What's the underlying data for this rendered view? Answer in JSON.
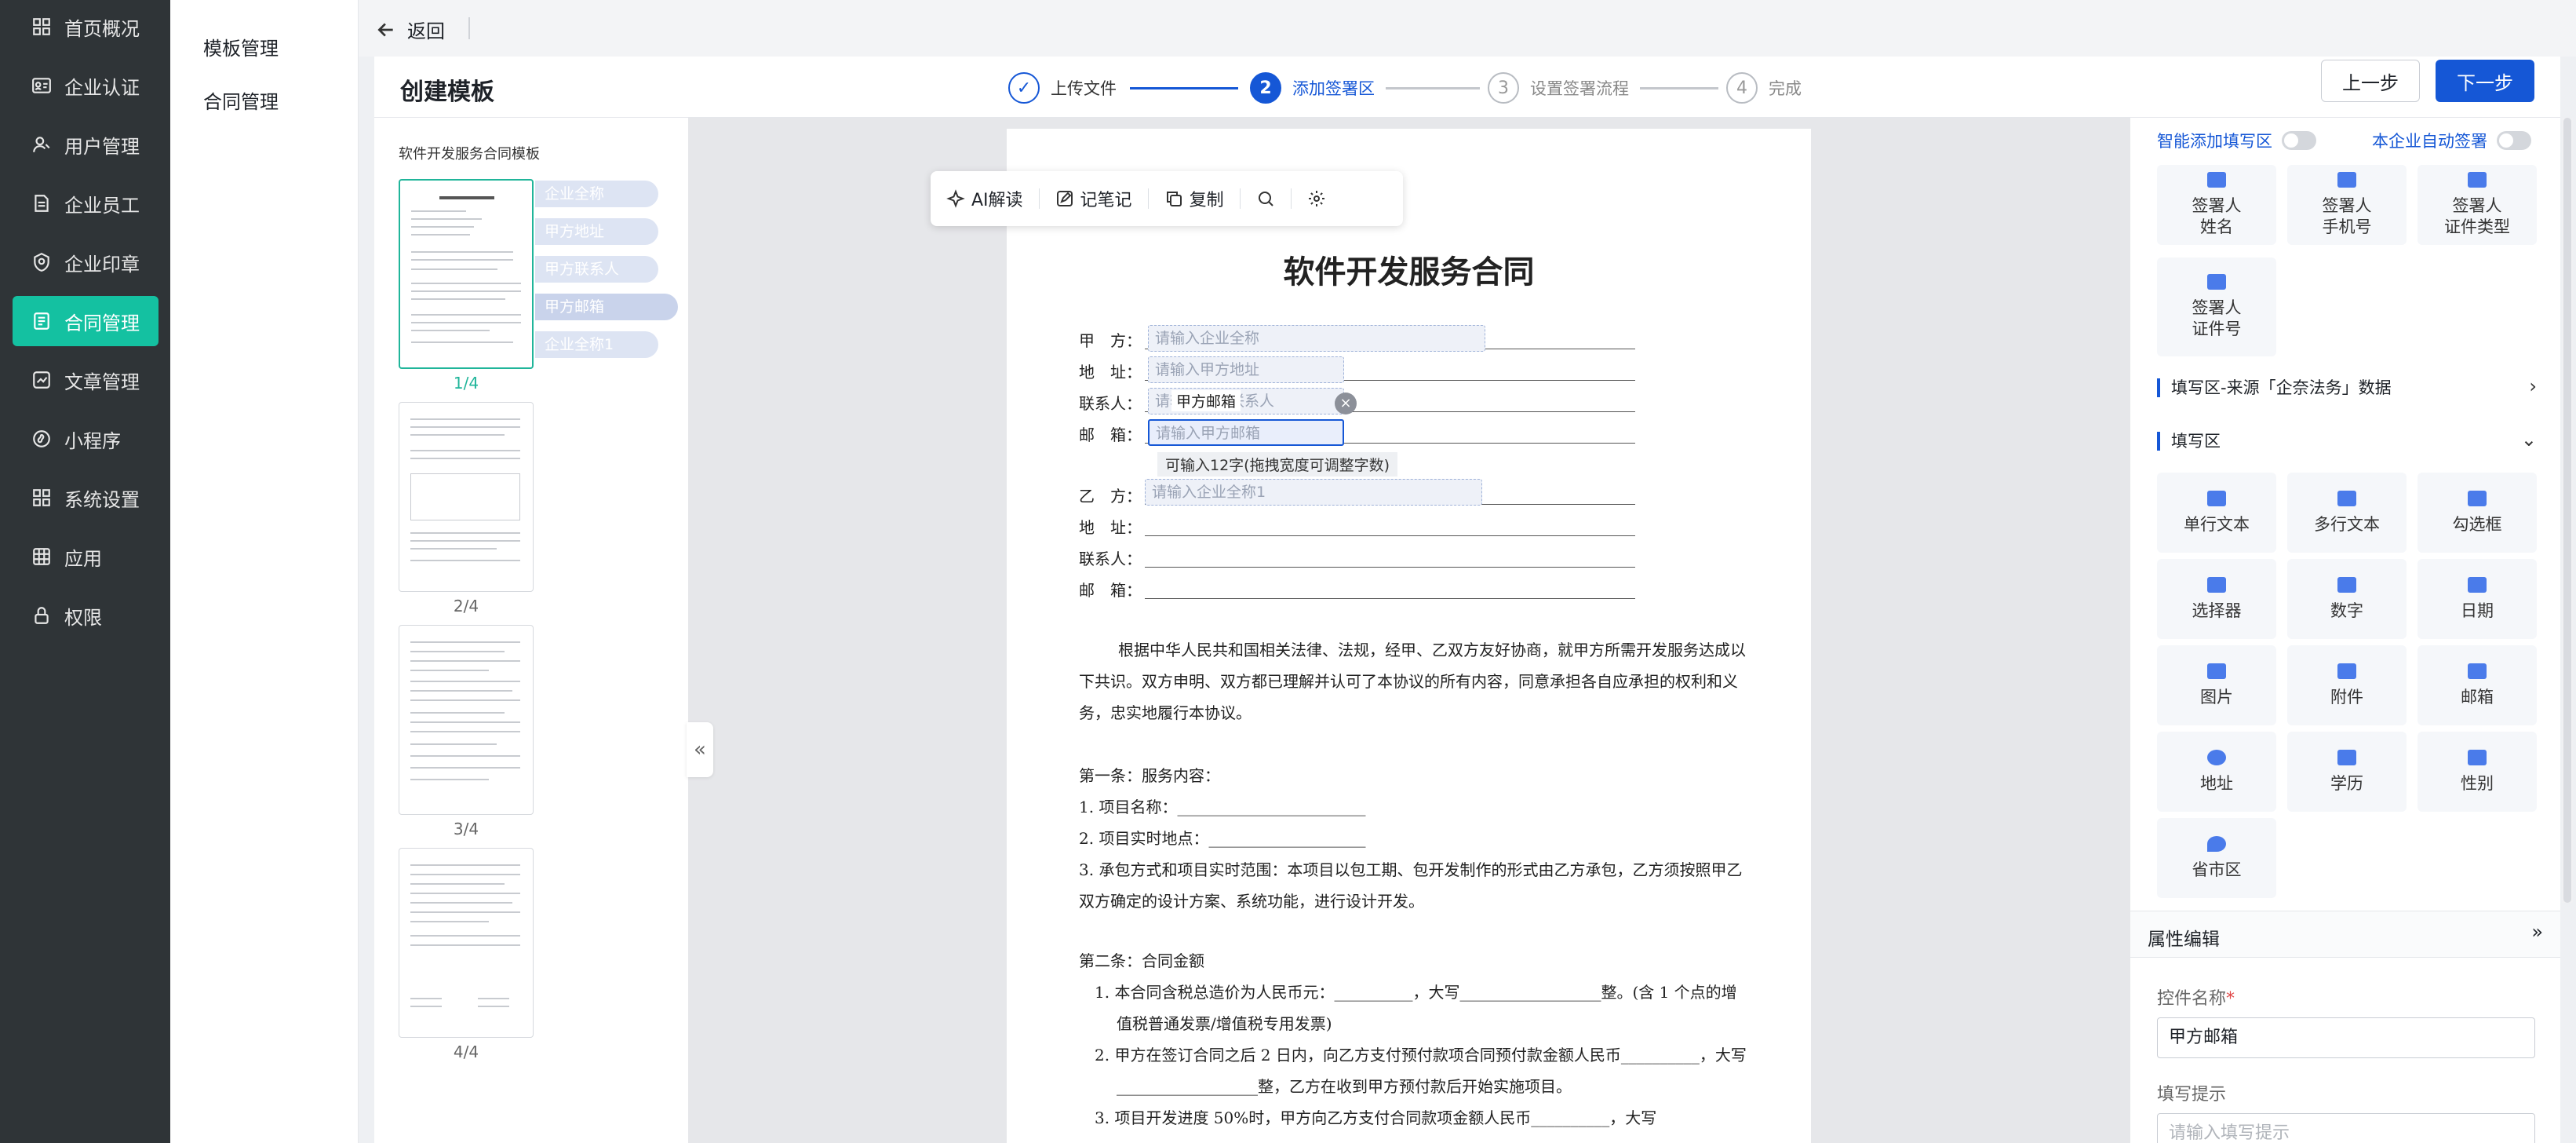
{
  "sidebar": {
    "items": [
      {
        "label": "首页概况",
        "icon": "dashboard-icon"
      },
      {
        "label": "企业认证",
        "icon": "id-card-icon"
      },
      {
        "label": "用户管理",
        "icon": "user-icon"
      },
      {
        "label": "企业员工",
        "icon": "document-icon"
      },
      {
        "label": "企业印章",
        "icon": "seal-icon"
      },
      {
        "label": "合同管理",
        "icon": "contract-icon"
      },
      {
        "label": "文章管理",
        "icon": "article-icon"
      },
      {
        "label": "小程序",
        "icon": "miniapp-icon"
      },
      {
        "label": "系统设置",
        "icon": "settings-grid-icon"
      },
      {
        "label": "应用",
        "icon": "app-icon"
      },
      {
        "label": "权限",
        "icon": "lock-icon"
      }
    ],
    "active_index": 5,
    "active_color": "#14c1a1"
  },
  "submenu": {
    "items": [
      "模板管理",
      "合同管理"
    ]
  },
  "backbar": {
    "back_label": "返回"
  },
  "header": {
    "title": "创建模板",
    "steps": [
      {
        "num": "✓",
        "label": "上传文件",
        "state": "done"
      },
      {
        "num": "2",
        "label": "添加签署区",
        "state": "current"
      },
      {
        "num": "3",
        "label": "设置签署流程",
        "state": "todo"
      },
      {
        "num": "4",
        "label": "完成",
        "state": "todo"
      }
    ],
    "prev_label": "上一步",
    "next_label": "下一步",
    "accent": "#1557d6"
  },
  "thumbs": {
    "doc_name": "软件开发服务合同模板",
    "pages": [
      "1/4",
      "2/4",
      "3/4",
      "4/4"
    ],
    "active_page": "1/4",
    "tags": [
      "企业全称",
      "甲方地址",
      "甲方联系人",
      "甲方邮箱",
      "企业全称1"
    ]
  },
  "toolbar": {
    "ai_label": "AI解读",
    "note_label": "记笔记",
    "copy_label": "复制"
  },
  "document": {
    "title": "软件开发服务合同",
    "party_a": {
      "labels": [
        "甲　方：",
        "地　址：",
        "联系人：",
        "邮　箱："
      ],
      "fields": [
        "请输入企业全称",
        "请输入甲方地址",
        "请输入甲方联系人",
        "请输入甲方邮箱"
      ],
      "floating_label": "甲方邮箱",
      "hint": "可输入12字(拖拽宽度可调整字数)"
    },
    "party_b": {
      "labels": [
        "乙　方：",
        "地　址：",
        "联系人：",
        "邮　箱："
      ],
      "field": "请输入企业全称1"
    },
    "intro": "根据中华人民共和国相关法律、法规，经甲、乙双方友好协商，就甲方所需开发服务达成以下共识。双方申明、双方都已理解并认可了本协议的所有内容，同意承担各自应承担的权利和义务，忠实地履行本协议。",
    "section1_title": "第一条：服务内容：",
    "section1_items": [
      "1. 项目名称：________________________",
      "2. 项目实时地点：____________________",
      "3. 承包方式和项目实时范围：本项目以包工期、包开发制作的形式由乙方承包，乙方须按照甲乙双方确定的设计方案、系统功能，进行设计开发。"
    ],
    "section2_title": "第二条：合同金额",
    "section2_items": [
      "1. 本合同含税总造价为人民币元：__________，大写__________________整。(含 1 个点的增值税普通发票/增值税专用发票)",
      "2. 甲方在签订合同之后 2 日内，向乙方支付预付款项合同预付款金额人民币__________，大写__________________整，乙方在收到甲方预付款后开始实施项目。",
      "3. 项目开发进度 50%时，甲方向乙方支付合同款项金额人民币__________，大写"
    ]
  },
  "rpanel": {
    "toggle_smart": "智能添加填写区",
    "toggle_auto": "本企业自动签署",
    "signer_controls": [
      [
        "签署人",
        "姓名"
      ],
      [
        "签署人",
        "手机号"
      ],
      [
        "签署人",
        "证件类型"
      ],
      [
        "签署人",
        "证件号"
      ]
    ],
    "section_source": "填写区-来源「企奈法务」数据",
    "section_fill": "填写区",
    "fill_controls": [
      "单行文本",
      "多行文本",
      "勾选框",
      "选择器",
      "数字",
      "日期",
      "图片",
      "附件",
      "邮箱",
      "地址",
      "学历",
      "性别",
      "省市区"
    ],
    "prop_title": "属性编辑",
    "control_name_label": "控件名称",
    "control_name_value": "甲方邮箱",
    "fill_hint_label": "填写提示",
    "fill_hint_placeholder": "请输入填写提示"
  }
}
